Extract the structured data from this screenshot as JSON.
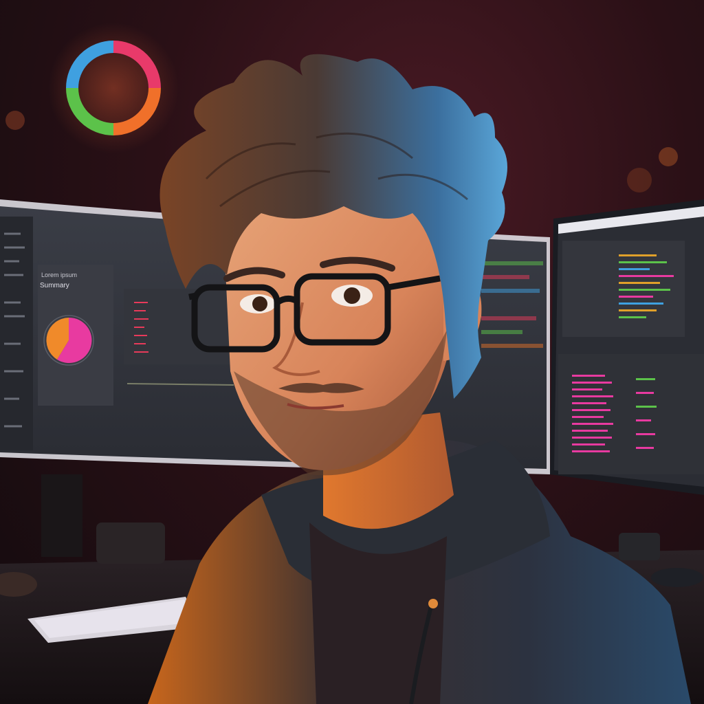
{
  "scene": {
    "description_items": [
      "character",
      "glasses",
      "hoodie",
      "curved-monitor",
      "side-monitor",
      "keyboard",
      "mouse",
      "wall-ring-light"
    ]
  },
  "monitor_left": {
    "panel_title": "Lorem ipsum",
    "panel_subtitle": "Summary"
  },
  "colors": {
    "accent_pink": "#e83aa0",
    "accent_orange": "#f08a2a",
    "accent_blue": "#3fa0e0",
    "accent_green": "#5cc24a",
    "hair_blue": "#3b7fb6",
    "hoodie": "#2a2e36"
  }
}
